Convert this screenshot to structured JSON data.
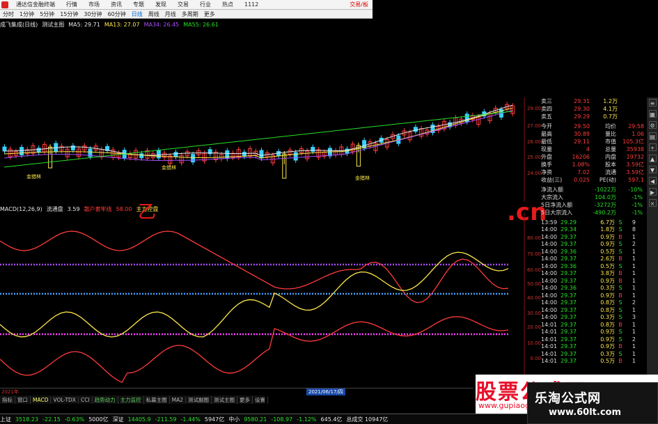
{
  "menubar": {
    "app_title": "通达信金融终端",
    "items": [
      "行情",
      "市场",
      "资讯",
      "专题",
      "发现",
      "交易",
      "行业",
      "热点",
      "1112"
    ],
    "trade_link": "交易/板"
  },
  "periodbar": {
    "items": [
      "分时",
      "1分钟",
      "5分钟",
      "15分钟",
      "30分钟",
      "60分钟",
      "日线",
      "周线",
      "月线",
      "多周期",
      "更多"
    ],
    "active_index": 6
  },
  "ma_row": {
    "title": "成飞集成(日线)",
    "template": "测试主图",
    "ma5": "MA5: 29.71",
    "ma13": "MA13: 27.07",
    "ma34": "MA34: 26.45",
    "ma55": "MA55: 26.61"
  },
  "main_axis": [
    "29.00",
    "27.00",
    "26.00",
    "25.00",
    "24.00"
  ],
  "candle_labels": [
    "金猎林",
    "金猎林",
    "金猎林"
  ],
  "indicator_row": {
    "name": "MACD(12,26,9)",
    "flow_label": "流通盘",
    "flow_value": "3.59",
    "buy_label": "散户套牢线",
    "buy_value": "58.00",
    "main_label": "主力控盘"
  },
  "sub_axis": [
    "80.00",
    "70.00",
    "60.00",
    "50.00",
    "40.00",
    "30.00",
    "20.00",
    "10.00",
    "0.00"
  ],
  "quote": {
    "sells": [
      {
        "label": "卖三",
        "price": "29.31",
        "vol": "1.2万"
      },
      {
        "label": "卖四",
        "price": "29.30",
        "vol": "4.1万"
      },
      {
        "label": "卖五",
        "price": "29.29",
        "vol": "0.7万"
      }
    ],
    "rows": [
      {
        "l": "今开",
        "v": "29.50",
        "l2": "均价",
        "v2": "29.58"
      },
      {
        "l": "最高",
        "v": "30.89",
        "l2": "量比",
        "v2": "1.06"
      },
      {
        "l": "最低",
        "v": "29.11",
        "l2": "市值",
        "v2": "105.3亿"
      },
      {
        "l": "现量",
        "v": "4",
        "l2": "总量",
        "v2": "35938"
      },
      {
        "l": "外盘",
        "v": "16206",
        "l2": "内盘",
        "v2": "19732"
      },
      {
        "l": "换手",
        "v": "1.08%",
        "l2": "股本",
        "v2": "3.59亿"
      },
      {
        "l": "净资",
        "v": "7.02",
        "l2": "流通",
        "v2": "3.59亿"
      },
      {
        "l": "收益(三)",
        "v": "0.025",
        "l2": "PE(动)",
        "v2": "597.1"
      }
    ],
    "flows": [
      {
        "label": "净流入额",
        "value": "-1022万",
        "pct": "-10%"
      },
      {
        "label": "大宗流入",
        "value": "104.0万",
        "pct": "-1%"
      },
      {
        "label": "5日净流入额",
        "value": "-3272万",
        "pct": "-1%"
      },
      {
        "label": "5日大宗流入",
        "value": "-490.2万",
        "pct": "-1%"
      }
    ],
    "ticks": [
      {
        "t": "13:59",
        "p": "29.29",
        "q": "6.7万",
        "d": "S",
        "n": "9"
      },
      {
        "t": "14:00",
        "p": "29.34",
        "q": "1.8万",
        "d": "S",
        "n": "8"
      },
      {
        "t": "14:00",
        "p": "29.37",
        "q": "0.9万",
        "d": "B",
        "n": "1"
      },
      {
        "t": "14:00",
        "p": "29.37",
        "q": "0.9万",
        "d": "S",
        "n": "2"
      },
      {
        "t": "14:00",
        "p": "29.36",
        "q": "0.5万",
        "d": "S",
        "n": "1"
      },
      {
        "t": "14:00",
        "p": "29.37",
        "q": "2.6万",
        "d": "B",
        "n": "1"
      },
      {
        "t": "14:00",
        "p": "29.36",
        "q": "0.5万",
        "d": "S",
        "n": "1"
      },
      {
        "t": "14:00",
        "p": "29.37",
        "q": "3.8万",
        "d": "B",
        "n": "1"
      },
      {
        "t": "14:00",
        "p": "29.37",
        "q": "0.9万",
        "d": "B",
        "n": "1"
      },
      {
        "t": "14:00",
        "p": "29.36",
        "q": "0.3万",
        "d": "S",
        "n": "1"
      },
      {
        "t": "14:00",
        "p": "29.37",
        "q": "0.9万",
        "d": "B",
        "n": "1"
      },
      {
        "t": "14:00",
        "p": "29.37",
        "q": "0.8万",
        "d": "S",
        "n": "2"
      },
      {
        "t": "14:00",
        "p": "29.37",
        "q": "0.8万",
        "d": "S",
        "n": "1"
      },
      {
        "t": "14:00",
        "p": "29.37",
        "q": "0.3万",
        "d": "S",
        "n": "3"
      },
      {
        "t": "14:01",
        "p": "29.37",
        "q": "0.8万",
        "d": "B",
        "n": "1"
      },
      {
        "t": "14:01",
        "p": "29.37",
        "q": "0.9万",
        "d": "S",
        "n": "1"
      },
      {
        "t": "14:01",
        "p": "29.37",
        "q": "0.9万",
        "d": "S",
        "n": "2"
      },
      {
        "t": "14:01",
        "p": "29.37",
        "q": "0.9万",
        "d": "B",
        "n": "1"
      },
      {
        "t": "14:01",
        "p": "29.37",
        "q": "0.3万",
        "d": "S",
        "n": "1"
      },
      {
        "t": "14:01",
        "p": "29.37",
        "q": "0.5万",
        "d": "B",
        "n": "1"
      }
    ]
  },
  "datebar": {
    "start": "2021年",
    "highlight": "2021/06/17/四"
  },
  "tabs": [
    "指标",
    "窗口",
    "MACD",
    "VOL-TDX",
    "CCI",
    "趋势动力",
    "主力监控",
    "私募主图",
    "MA2",
    "测试副图",
    "测试主图",
    "更多",
    "设置"
  ],
  "tabs_active": 2,
  "tabs_highlight": [
    5,
    6
  ],
  "status": [
    {
      "name": "上证",
      "val": "3518.23",
      "chg": "-22.15",
      "pct": "-0.63%",
      "amt": "5000亿"
    },
    {
      "name": "深证",
      "val": "14405.9",
      "chg": "-211.59",
      "pct": "-1.44%",
      "amt": "5947亿"
    },
    {
      "name": "中小",
      "val": "9580.21",
      "chg": "-108.97",
      "pct": "-1.12%",
      "amt": "645.4亿"
    }
  ],
  "status_tail": "总成交 10947亿",
  "watermark": {
    "big": "股票公式网",
    "sub": "www.gupiaogongshi.net",
    "site": "乐淘公式网",
    "url": "www.60lt.com"
  },
  "marks": {
    "cn": ".cn",
    "zh": "乙"
  },
  "colors": {
    "up": "#ff3c3c",
    "down": "#28e028",
    "yellow": "#ffe94a",
    "purple": "#a64dff",
    "magenta": "#ff40ff"
  }
}
